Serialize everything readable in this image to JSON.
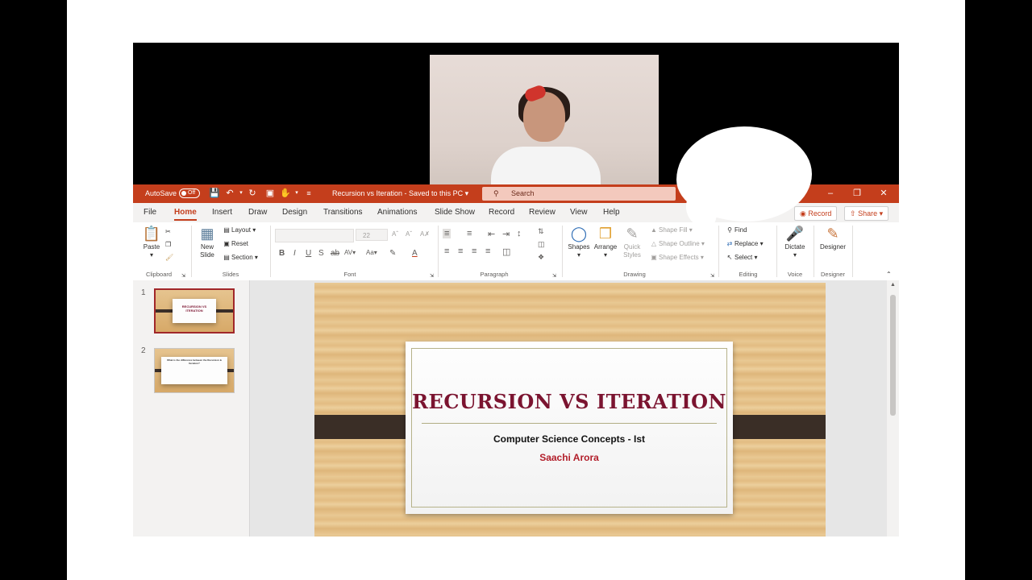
{
  "titlebar": {
    "autosave_label": "AutoSave",
    "autosave_state": "Off",
    "document_title": "Recursion vs Iteration - Saved to this PC",
    "search_placeholder": "Search",
    "accent_color": "#c43e1c"
  },
  "menu": {
    "tabs": [
      "File",
      "Home",
      "Insert",
      "Draw",
      "Design",
      "Transitions",
      "Animations",
      "Slide Show",
      "Record",
      "Review",
      "View",
      "Help"
    ],
    "active": "Home",
    "record_button": "Record",
    "share_button": "Share"
  },
  "ribbon": {
    "clipboard": {
      "label": "Clipboard",
      "paste": "Paste"
    },
    "slides": {
      "label": "Slides",
      "new_slide_1": "New",
      "new_slide_2": "Slide",
      "layout": "Layout",
      "reset": "Reset",
      "section": "Section"
    },
    "font": {
      "label": "Font",
      "size_value": "22"
    },
    "paragraph": {
      "label": "Paragraph"
    },
    "drawing": {
      "label": "Drawing",
      "shapes": "Shapes",
      "arrange": "Arrange",
      "quick_styles_1": "Quick",
      "quick_styles_2": "Styles",
      "shape_fill": "Shape Fill",
      "shape_outline": "Shape Outline",
      "shape_effects": "Shape Effects"
    },
    "editing": {
      "label": "Editing",
      "find": "Find",
      "replace": "Replace",
      "select": "Select"
    },
    "voice": {
      "label": "Voice",
      "dictate": "Dictate"
    },
    "designer": {
      "label": "Designer",
      "designer": "Designer"
    }
  },
  "thumbnails": [
    {
      "number": "1",
      "title": "RECURSION VS ITERATION",
      "selected": true
    },
    {
      "number": "2",
      "title": "What is the difference between the Recursion & Iteration?",
      "selected": false
    }
  ],
  "slide": {
    "title": "RECURSION VS ITERATION",
    "subtitle": "Computer Science Concepts - Ist",
    "author": "Saachi Arora"
  }
}
